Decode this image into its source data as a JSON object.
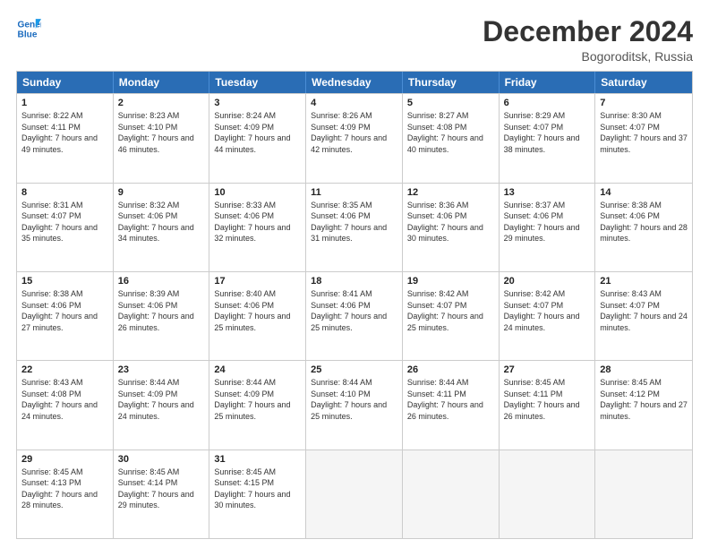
{
  "header": {
    "logo_line1": "General",
    "logo_line2": "Blue",
    "month_title": "December 2024",
    "location": "Bogoroditsk, Russia"
  },
  "weekdays": [
    "Sunday",
    "Monday",
    "Tuesday",
    "Wednesday",
    "Thursday",
    "Friday",
    "Saturday"
  ],
  "weeks": [
    [
      {
        "day": "1",
        "sunrise": "Sunrise: 8:22 AM",
        "sunset": "Sunset: 4:11 PM",
        "daylight": "Daylight: 7 hours and 49 minutes."
      },
      {
        "day": "2",
        "sunrise": "Sunrise: 8:23 AM",
        "sunset": "Sunset: 4:10 PM",
        "daylight": "Daylight: 7 hours and 46 minutes."
      },
      {
        "day": "3",
        "sunrise": "Sunrise: 8:24 AM",
        "sunset": "Sunset: 4:09 PM",
        "daylight": "Daylight: 7 hours and 44 minutes."
      },
      {
        "day": "4",
        "sunrise": "Sunrise: 8:26 AM",
        "sunset": "Sunset: 4:09 PM",
        "daylight": "Daylight: 7 hours and 42 minutes."
      },
      {
        "day": "5",
        "sunrise": "Sunrise: 8:27 AM",
        "sunset": "Sunset: 4:08 PM",
        "daylight": "Daylight: 7 hours and 40 minutes."
      },
      {
        "day": "6",
        "sunrise": "Sunrise: 8:29 AM",
        "sunset": "Sunset: 4:07 PM",
        "daylight": "Daylight: 7 hours and 38 minutes."
      },
      {
        "day": "7",
        "sunrise": "Sunrise: 8:30 AM",
        "sunset": "Sunset: 4:07 PM",
        "daylight": "Daylight: 7 hours and 37 minutes."
      }
    ],
    [
      {
        "day": "8",
        "sunrise": "Sunrise: 8:31 AM",
        "sunset": "Sunset: 4:07 PM",
        "daylight": "Daylight: 7 hours and 35 minutes."
      },
      {
        "day": "9",
        "sunrise": "Sunrise: 8:32 AM",
        "sunset": "Sunset: 4:06 PM",
        "daylight": "Daylight: 7 hours and 34 minutes."
      },
      {
        "day": "10",
        "sunrise": "Sunrise: 8:33 AM",
        "sunset": "Sunset: 4:06 PM",
        "daylight": "Daylight: 7 hours and 32 minutes."
      },
      {
        "day": "11",
        "sunrise": "Sunrise: 8:35 AM",
        "sunset": "Sunset: 4:06 PM",
        "daylight": "Daylight: 7 hours and 31 minutes."
      },
      {
        "day": "12",
        "sunrise": "Sunrise: 8:36 AM",
        "sunset": "Sunset: 4:06 PM",
        "daylight": "Daylight: 7 hours and 30 minutes."
      },
      {
        "day": "13",
        "sunrise": "Sunrise: 8:37 AM",
        "sunset": "Sunset: 4:06 PM",
        "daylight": "Daylight: 7 hours and 29 minutes."
      },
      {
        "day": "14",
        "sunrise": "Sunrise: 8:38 AM",
        "sunset": "Sunset: 4:06 PM",
        "daylight": "Daylight: 7 hours and 28 minutes."
      }
    ],
    [
      {
        "day": "15",
        "sunrise": "Sunrise: 8:38 AM",
        "sunset": "Sunset: 4:06 PM",
        "daylight": "Daylight: 7 hours and 27 minutes."
      },
      {
        "day": "16",
        "sunrise": "Sunrise: 8:39 AM",
        "sunset": "Sunset: 4:06 PM",
        "daylight": "Daylight: 7 hours and 26 minutes."
      },
      {
        "day": "17",
        "sunrise": "Sunrise: 8:40 AM",
        "sunset": "Sunset: 4:06 PM",
        "daylight": "Daylight: 7 hours and 25 minutes."
      },
      {
        "day": "18",
        "sunrise": "Sunrise: 8:41 AM",
        "sunset": "Sunset: 4:06 PM",
        "daylight": "Daylight: 7 hours and 25 minutes."
      },
      {
        "day": "19",
        "sunrise": "Sunrise: 8:42 AM",
        "sunset": "Sunset: 4:07 PM",
        "daylight": "Daylight: 7 hours and 25 minutes."
      },
      {
        "day": "20",
        "sunrise": "Sunrise: 8:42 AM",
        "sunset": "Sunset: 4:07 PM",
        "daylight": "Daylight: 7 hours and 24 minutes."
      },
      {
        "day": "21",
        "sunrise": "Sunrise: 8:43 AM",
        "sunset": "Sunset: 4:07 PM",
        "daylight": "Daylight: 7 hours and 24 minutes."
      }
    ],
    [
      {
        "day": "22",
        "sunrise": "Sunrise: 8:43 AM",
        "sunset": "Sunset: 4:08 PM",
        "daylight": "Daylight: 7 hours and 24 minutes."
      },
      {
        "day": "23",
        "sunrise": "Sunrise: 8:44 AM",
        "sunset": "Sunset: 4:09 PM",
        "daylight": "Daylight: 7 hours and 24 minutes."
      },
      {
        "day": "24",
        "sunrise": "Sunrise: 8:44 AM",
        "sunset": "Sunset: 4:09 PM",
        "daylight": "Daylight: 7 hours and 25 minutes."
      },
      {
        "day": "25",
        "sunrise": "Sunrise: 8:44 AM",
        "sunset": "Sunset: 4:10 PM",
        "daylight": "Daylight: 7 hours and 25 minutes."
      },
      {
        "day": "26",
        "sunrise": "Sunrise: 8:44 AM",
        "sunset": "Sunset: 4:11 PM",
        "daylight": "Daylight: 7 hours and 26 minutes."
      },
      {
        "day": "27",
        "sunrise": "Sunrise: 8:45 AM",
        "sunset": "Sunset: 4:11 PM",
        "daylight": "Daylight: 7 hours and 26 minutes."
      },
      {
        "day": "28",
        "sunrise": "Sunrise: 8:45 AM",
        "sunset": "Sunset: 4:12 PM",
        "daylight": "Daylight: 7 hours and 27 minutes."
      }
    ],
    [
      {
        "day": "29",
        "sunrise": "Sunrise: 8:45 AM",
        "sunset": "Sunset: 4:13 PM",
        "daylight": "Daylight: 7 hours and 28 minutes."
      },
      {
        "day": "30",
        "sunrise": "Sunrise: 8:45 AM",
        "sunset": "Sunset: 4:14 PM",
        "daylight": "Daylight: 7 hours and 29 minutes."
      },
      {
        "day": "31",
        "sunrise": "Sunrise: 8:45 AM",
        "sunset": "Sunset: 4:15 PM",
        "daylight": "Daylight: 7 hours and 30 minutes."
      },
      null,
      null,
      null,
      null
    ]
  ]
}
